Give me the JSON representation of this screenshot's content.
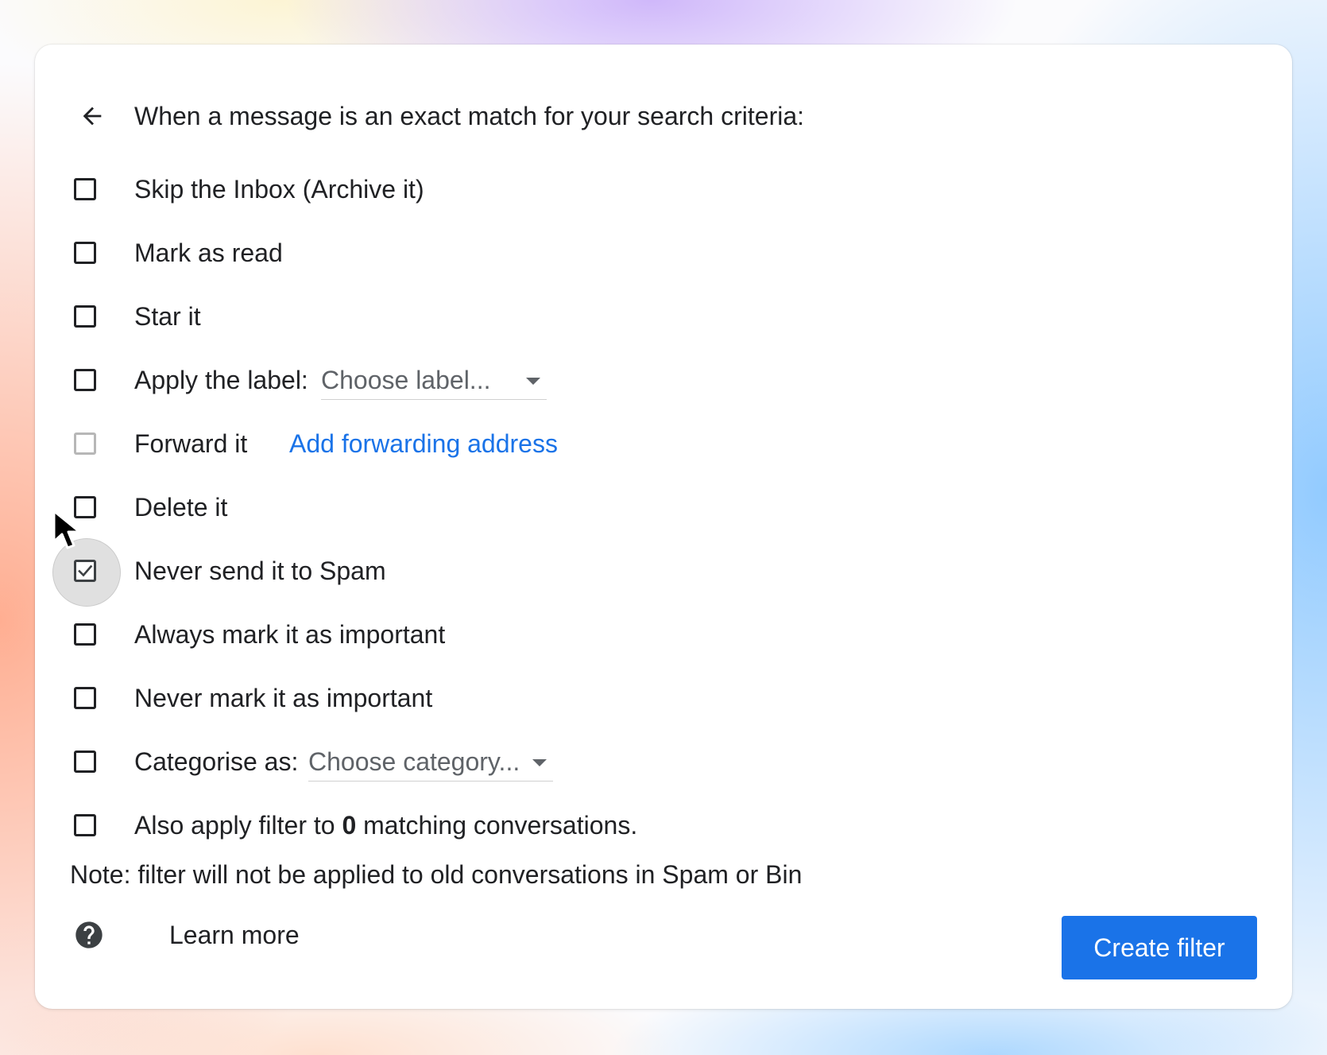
{
  "header": {
    "title": "When a message is an exact match for your search criteria:"
  },
  "options": [
    {
      "label": "Skip the Inbox (Archive it)",
      "checked": false
    },
    {
      "label": "Mark as read",
      "checked": false
    },
    {
      "label": "Star it",
      "checked": false
    },
    {
      "label": "Apply the label:",
      "checked": false,
      "select_value": "Choose label..."
    },
    {
      "label": "Forward it",
      "checked": false,
      "disabled": true,
      "link": "Add forwarding address"
    },
    {
      "label": "Delete it",
      "checked": false
    },
    {
      "label": "Never send it to Spam",
      "checked": true
    },
    {
      "label": "Always mark it as important",
      "checked": false
    },
    {
      "label": "Never mark it as important",
      "checked": false
    },
    {
      "label": "Categorise as:",
      "checked": false,
      "select_value": "Choose category..."
    },
    {
      "label_before": "Also apply filter to",
      "count": "0",
      "label_after": "matching conversations.",
      "checked": false
    }
  ],
  "note": "Note: filter will not be applied to old conversations in Spam or Bin",
  "footer": {
    "learn_more": "Learn more",
    "create_button": "Create filter"
  },
  "colors": {
    "accent": "#1a73e8",
    "text": "#202124",
    "muted": "#5f6368"
  },
  "icons": {
    "back": "arrow-left-icon",
    "help": "help-circle-icon",
    "checkmark": "checkmark-icon",
    "cursor": "mouse-pointer-icon",
    "caret": "caret-down-icon"
  }
}
